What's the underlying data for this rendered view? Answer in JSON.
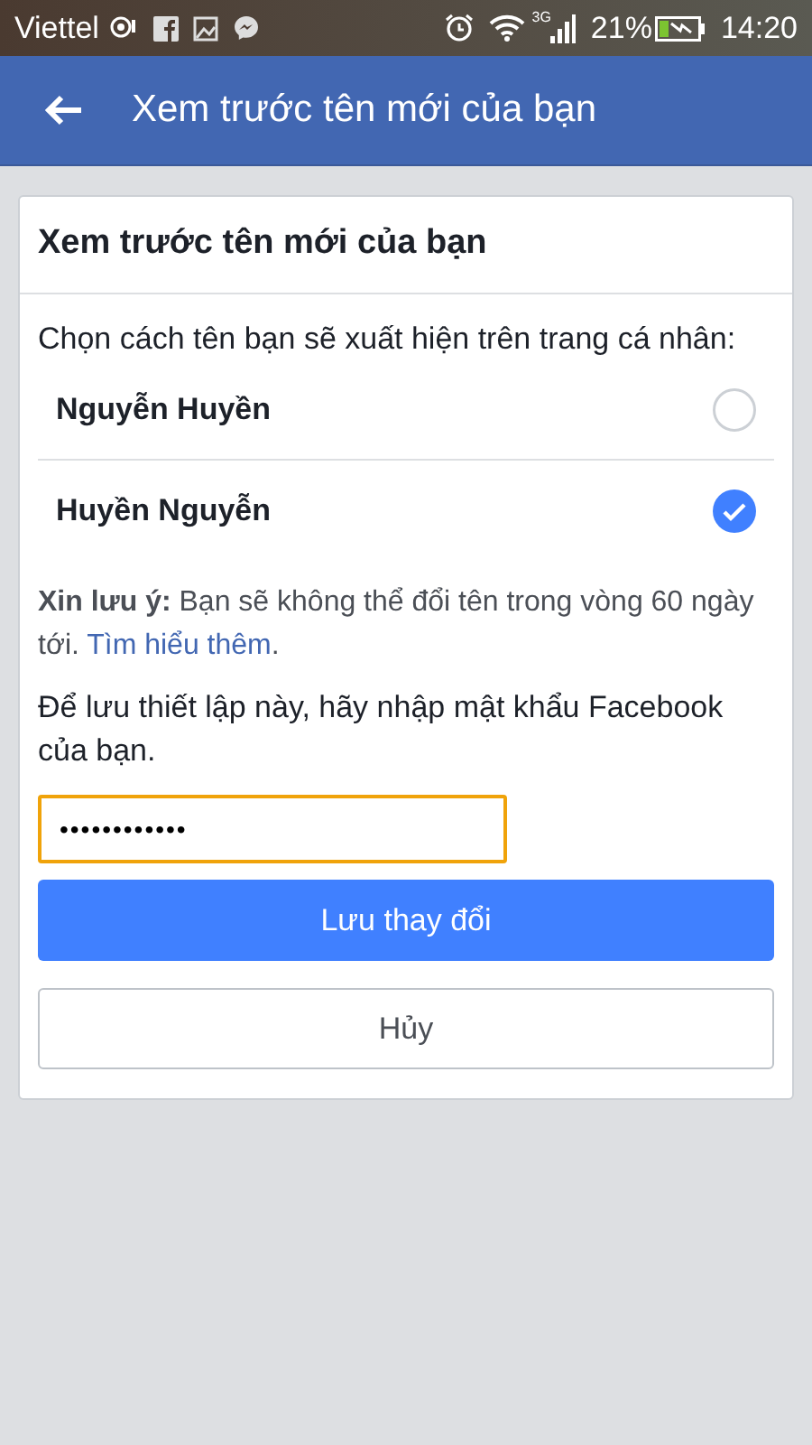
{
  "status_bar": {
    "carrier": "Viettel",
    "network": "3G",
    "battery": "21%",
    "time": "14:20"
  },
  "app_bar": {
    "title": "Xem trước tên mới của bạn"
  },
  "card": {
    "title": "Xem trước tên mới của bạn",
    "prompt": "Chọn cách tên bạn sẽ xuất hiện trên trang cá nhân:",
    "options": [
      {
        "label": "Nguyễn Huyền",
        "selected": false
      },
      {
        "label": "Huyền Nguyễn",
        "selected": true
      }
    ],
    "note": {
      "text": "**Xin lưu ý:** Bạn sẽ không thể đổi tên trong vòng 60 ngày tới.",
      "link": "Tìm hiểu thêm",
      "end": "."
    },
    "password_prompt": "Để lưu thiết lập này, hãy nhập mật khẩu Facebook của bạn.",
    "password": {
      "value": "••••••••••••",
      "focused": true
    },
    "buttons": [
      {
        "label": "Lưu thay đổi",
        "kind": "primary"
      },
      {
        "label": "Hủy",
        "kind": "secondary"
      }
    ]
  }
}
